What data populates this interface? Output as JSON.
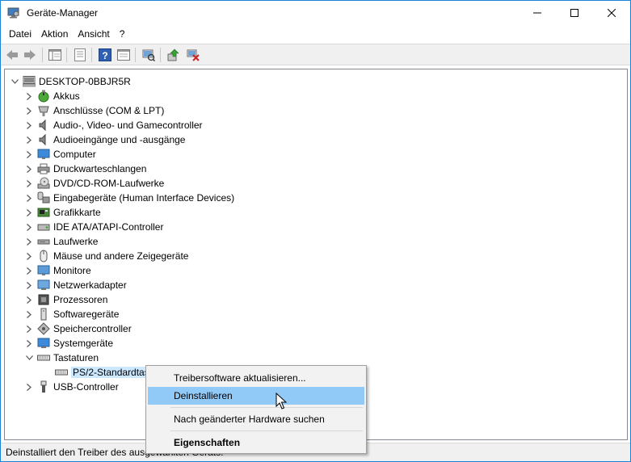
{
  "window": {
    "title": "Geräte-Manager",
    "controls": {
      "minimize": "—",
      "maximize": "☐",
      "close": "✕"
    }
  },
  "menubar": {
    "items": [
      "Datei",
      "Aktion",
      "Ansicht",
      "?"
    ]
  },
  "toolbar": {
    "buttons": [
      "back-icon",
      "forward-icon",
      "show-hide-console-tree-icon",
      "properties-icon",
      "help-icon",
      "properties-sheet-icon",
      "scan-hardware-icon",
      "update-driver-icon",
      "uninstall-device-icon"
    ]
  },
  "tree": {
    "root": "DESKTOP-0BBJR5R",
    "categories": [
      "Akkus",
      "Anschlüsse (COM & LPT)",
      "Audio-, Video- und Gamecontroller",
      "Audioeingänge und -ausgänge",
      "Computer",
      "Druckwarteschlangen",
      "DVD/CD-ROM-Laufwerke",
      "Eingabegeräte (Human Interface Devices)",
      "Grafikkarte",
      "IDE ATA/ATAPI-Controller",
      "Laufwerke",
      "Mäuse und andere Zeigegeräte",
      "Monitore",
      "Netzwerkadapter",
      "Prozessoren",
      "Softwaregeräte",
      "Speichercontroller",
      "Systemgeräte",
      "Tastaturen",
      "USB-Controller"
    ],
    "expanded_child": "PS/2-Standardtastatur"
  },
  "statusbar": {
    "text": "Deinstalliert den Treiber des ausgewählten Geräts."
  },
  "context_menu": {
    "items": [
      "Treibersoftware aktualisieren...",
      "Deinstallieren",
      "Nach geänderter Hardware suchen",
      "Eigenschaften"
    ]
  },
  "colors": {
    "window_border": "#1883d7",
    "selection": "#cce8ff",
    "menu_highlight": "#91c9f7",
    "toolbar_bg": "#f0f0f0"
  }
}
